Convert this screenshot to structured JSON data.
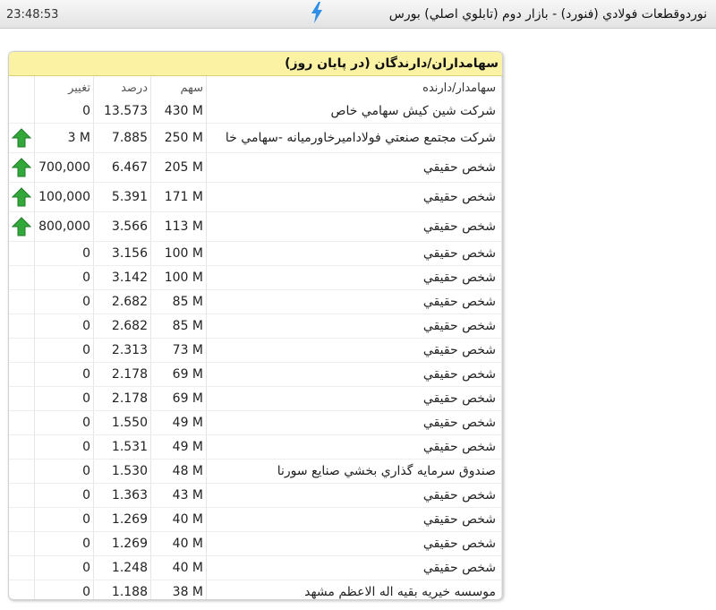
{
  "header": {
    "time": "23:48:53",
    "title": "نوردوقطعات فولادي (فنورد) - بازار دوم (تابلوي اصلي) بورس"
  },
  "panel": {
    "title": "سهامداران/دارندگان (در پایان روز)",
    "columns": {
      "holder": "سهامدار/دارنده",
      "shares": "سهم",
      "percent": "درصد",
      "change": "تغییر"
    },
    "rows": [
      {
        "holder": "شرکت شین کیش سهامي خاص",
        "shares": "430 M",
        "percent": "13.573",
        "change": "0",
        "trend": "none"
      },
      {
        "holder": "شرکت مجتمع صنعتي فولادامیرخاورمیانه -سهامي خا",
        "shares": "250 M",
        "percent": "7.885",
        "change": "3 M",
        "trend": "up"
      },
      {
        "holder": "شخص حقیقي",
        "shares": "205 M",
        "percent": "6.467",
        "change": "700,000",
        "trend": "up"
      },
      {
        "holder": "شخص حقیقي",
        "shares": "171 M",
        "percent": "5.391",
        "change": "100,000",
        "trend": "up"
      },
      {
        "holder": "شخص حقیقي",
        "shares": "113 M",
        "percent": "3.566",
        "change": "800,000",
        "trend": "up"
      },
      {
        "holder": "شخص حقیقي",
        "shares": "100 M",
        "percent": "3.156",
        "change": "0",
        "trend": "none"
      },
      {
        "holder": "شخص حقیقي",
        "shares": "100 M",
        "percent": "3.142",
        "change": "0",
        "trend": "none"
      },
      {
        "holder": "شخص حقیقي",
        "shares": "85 M",
        "percent": "2.682",
        "change": "0",
        "trend": "none"
      },
      {
        "holder": "شخص حقیقي",
        "shares": "85 M",
        "percent": "2.682",
        "change": "0",
        "trend": "none"
      },
      {
        "holder": "شخص حقیقي",
        "shares": "73 M",
        "percent": "2.313",
        "change": "0",
        "trend": "none"
      },
      {
        "holder": "شخص حقیقي",
        "shares": "69 M",
        "percent": "2.178",
        "change": "0",
        "trend": "none"
      },
      {
        "holder": "شخص حقیقي",
        "shares": "69 M",
        "percent": "2.178",
        "change": "0",
        "trend": "none"
      },
      {
        "holder": "شخص حقیقي",
        "shares": "49 M",
        "percent": "1.550",
        "change": "0",
        "trend": "none"
      },
      {
        "holder": "شخص حقیقي",
        "shares": "49 M",
        "percent": "1.531",
        "change": "0",
        "trend": "none"
      },
      {
        "holder": "صندوق سرمایه گذاري بخشي صنایع سورنا",
        "shares": "48 M",
        "percent": "1.530",
        "change": "0",
        "trend": "none"
      },
      {
        "holder": "شخص حقیقي",
        "shares": "43 M",
        "percent": "1.363",
        "change": "0",
        "trend": "none"
      },
      {
        "holder": "شخص حقیقي",
        "shares": "40 M",
        "percent": "1.269",
        "change": "0",
        "trend": "none"
      },
      {
        "holder": "شخص حقیقي",
        "shares": "40 M",
        "percent": "1.269",
        "change": "0",
        "trend": "none"
      },
      {
        "holder": "شخص حقیقي",
        "shares": "40 M",
        "percent": "1.248",
        "change": "0",
        "trend": "none"
      },
      {
        "holder": "موسسه خیریه بقیه اله الاعظم مشهد",
        "shares": "38 M",
        "percent": "1.188",
        "change": "0",
        "trend": "none"
      }
    ]
  },
  "colors": {
    "panel_header_bg": "#fbf3a3",
    "up_arrow": "#33a83a",
    "bolt": "#2f8fe6"
  },
  "icons": {
    "header_icon": "lightning-bolt-icon",
    "trend_up": "green-up-arrow-icon"
  }
}
